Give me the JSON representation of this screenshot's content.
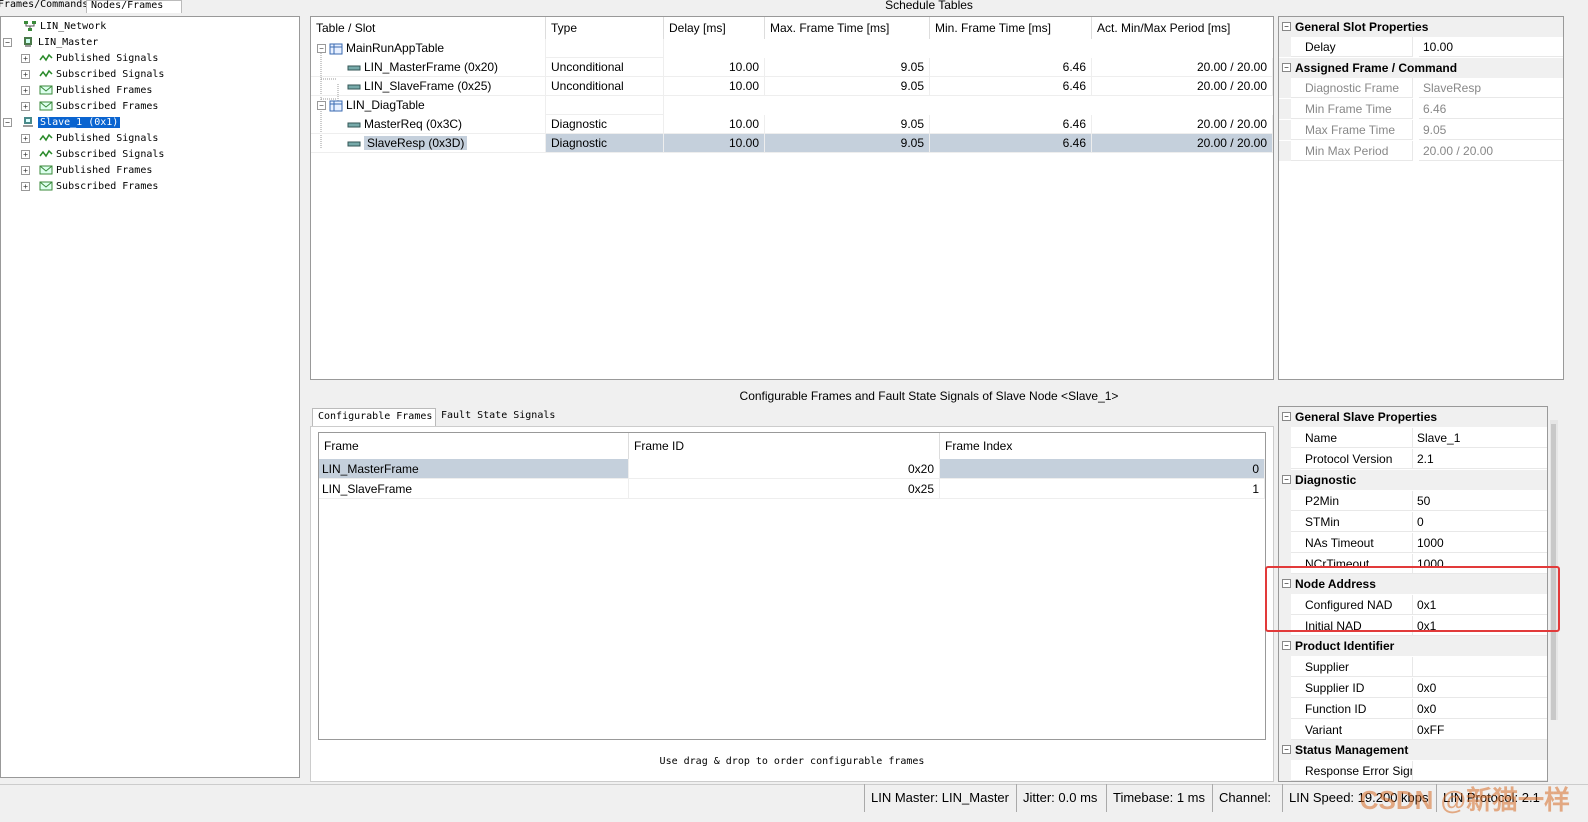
{
  "left_tabs": {
    "frames": "Frames/Commands",
    "nodes": "Nodes/Frames"
  },
  "tree": [
    {
      "label": "LIN_Network",
      "icon": "network-icon"
    },
    {
      "label": "LIN_Master",
      "icon": "master-node-icon"
    },
    {
      "label": "Published Signals",
      "icon": "signal-icon"
    },
    {
      "label": "Subscribed Signals",
      "icon": "signal-icon"
    },
    {
      "label": "Published Frames",
      "icon": "frame-icon"
    },
    {
      "label": "Subscribed Frames",
      "icon": "frame-icon"
    },
    {
      "label": "Slave_1 (0x1)",
      "icon": "slave-node-icon"
    },
    {
      "label": "Published Signals",
      "icon": "signal-icon"
    },
    {
      "label": "Subscribed Signals",
      "icon": "signal-icon"
    },
    {
      "label": "Published Frames",
      "icon": "frame-icon"
    },
    {
      "label": "Subscribed Frames",
      "icon": "frame-icon"
    }
  ],
  "schedule": {
    "title": "Schedule Tables",
    "headers": [
      "Table / Slot",
      "Type",
      "Delay [ms]",
      "Max. Frame Time [ms]",
      "Min. Frame Time [ms]",
      "Act. Min/Max Period [ms]"
    ],
    "rows": [
      {
        "name": "MainRunAppTable",
        "type": "",
        "delay": "",
        "max": "",
        "min": "",
        "period": ""
      },
      {
        "name": "LIN_MasterFrame (0x20)",
        "type": "Unconditional",
        "delay": "10.00",
        "max": "9.05",
        "min": "6.46",
        "period": "20.00 / 20.00"
      },
      {
        "name": "LIN_SlaveFrame (0x25)",
        "type": "Unconditional",
        "delay": "10.00",
        "max": "9.05",
        "min": "6.46",
        "period": "20.00 / 20.00"
      },
      {
        "name": "LIN_DiagTable",
        "type": "",
        "delay": "",
        "max": "",
        "min": "",
        "period": ""
      },
      {
        "name": "MasterReq (0x3C)",
        "type": "Diagnostic",
        "delay": "10.00",
        "max": "9.05",
        "min": "6.46",
        "period": "20.00 / 20.00"
      },
      {
        "name": "SlaveResp (0x3D)",
        "type": "Diagnostic",
        "delay": "10.00",
        "max": "9.05",
        "min": "6.46",
        "period": "20.00 / 20.00"
      }
    ]
  },
  "slot_props": {
    "cat1": "General Slot Properties",
    "delay_label": "Delay",
    "delay_value": "10.00",
    "cat2": "Assigned Frame / Command",
    "rows": [
      {
        "name": "Diagnostic Frame",
        "value": "SlaveResp"
      },
      {
        "name": "Min Frame Time",
        "value": "6.46"
      },
      {
        "name": "Max Frame Time",
        "value": "9.05"
      },
      {
        "name": "Min Max Period",
        "value": "20.00 / 20.00"
      }
    ]
  },
  "cfg": {
    "title": "Configurable Frames and Fault State Signals of Slave Node <Slave_1>",
    "tab_frames": "Configurable Frames",
    "tab_fault": "Fault State Signals",
    "headers": [
      "Frame",
      "Frame ID",
      "Frame Index"
    ],
    "rows": [
      {
        "frame": "LIN_MasterFrame",
        "id": "0x20",
        "index": "0"
      },
      {
        "frame": "LIN_SlaveFrame",
        "id": "0x25",
        "index": "1"
      }
    ],
    "footer": "Use drag & drop to order configurable frames"
  },
  "slave_props": {
    "sections": [
      {
        "title": "General Slave Properties",
        "rows": [
          {
            "name": "Name",
            "value": "Slave_1"
          },
          {
            "name": "Protocol Version",
            "value": "2.1"
          }
        ]
      },
      {
        "title": "Diagnostic",
        "rows": [
          {
            "name": "P2Min",
            "value": "50"
          },
          {
            "name": "STMin",
            "value": "0"
          },
          {
            "name": "NAs Timeout",
            "value": "1000"
          },
          {
            "name": "NCrTimeout",
            "value": "1000"
          }
        ]
      },
      {
        "title": "Node Address",
        "rows": [
          {
            "name": "Configured NAD",
            "value": "0x1"
          },
          {
            "name": "Initial NAD",
            "value": "0x1"
          }
        ]
      },
      {
        "title": "Product Identifier",
        "rows": [
          {
            "name": "Supplier",
            "value": ""
          },
          {
            "name": "Supplier ID",
            "value": "0x0"
          },
          {
            "name": "Function ID",
            "value": "0x0"
          },
          {
            "name": "Variant",
            "value": "0xFF"
          }
        ]
      },
      {
        "title": "Status Management",
        "rows": [
          {
            "name": "Response Error Sign",
            "value": ""
          }
        ]
      }
    ]
  },
  "status": {
    "master": "LIN Master: LIN_Master",
    "jitter": "Jitter: 0.0 ms",
    "timebase": "Timebase: 1 ms",
    "channel": "Channel:",
    "speed": "LIN Speed: 19.200 kbps",
    "protocol": "LIN Protocol: 2.1",
    "watermark": "CSDN @新猫一样"
  },
  "colors": {
    "selection": "#0a64d0",
    "row_highlight": "#c5d0dc",
    "annotation": "#e23a3a"
  }
}
